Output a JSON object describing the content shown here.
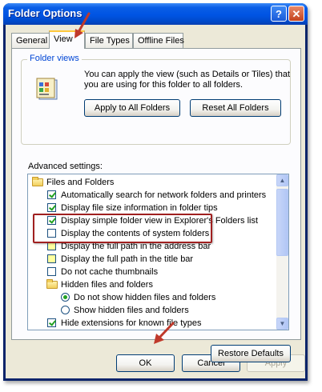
{
  "window": {
    "title": "Folder Options"
  },
  "titlebar_buttons": {
    "help": "?",
    "close": "✕"
  },
  "tabs": [
    {
      "label": "General",
      "active": false
    },
    {
      "label": "View",
      "active": true
    },
    {
      "label": "File Types",
      "active": false
    },
    {
      "label": "Offline Files",
      "active": false
    }
  ],
  "folder_views": {
    "label": "Folder views",
    "description": "You can apply the view (such as Details or Tiles) that you are using for this folder to all folders.",
    "apply_button": "Apply to All Folders",
    "reset_button": "Reset All Folders"
  },
  "advanced": {
    "label": "Advanced settings:",
    "items": [
      {
        "kind": "folder",
        "label": "Files and Folders"
      },
      {
        "kind": "checkbox",
        "checked": true,
        "label": "Automatically search for network folders and printers"
      },
      {
        "kind": "checkbox",
        "checked": true,
        "label": "Display file size information in folder tips"
      },
      {
        "kind": "checkbox",
        "checked": true,
        "label": "Display simple folder view in Explorer's Folders list"
      },
      {
        "kind": "checkbox",
        "checked": false,
        "label": "Display the contents of system folders"
      },
      {
        "kind": "checkbox",
        "checked": false,
        "label": "Display the full path in the address bar"
      },
      {
        "kind": "checkbox",
        "checked": false,
        "label": "Display the full path in the title bar"
      },
      {
        "kind": "checkbox",
        "checked": false,
        "label": "Do not cache thumbnails"
      },
      {
        "kind": "folder",
        "label": "Hidden files and folders"
      },
      {
        "kind": "radio",
        "checked": true,
        "label": "Do not show hidden files and folders"
      },
      {
        "kind": "radio",
        "checked": false,
        "label": "Show hidden files and folders"
      },
      {
        "kind": "checkbox",
        "checked": true,
        "label": "Hide extensions for known file types"
      }
    ]
  },
  "restore_button": "Restore Defaults",
  "dialog_buttons": {
    "ok": "OK",
    "cancel": "Cancel",
    "apply": "Apply"
  },
  "colors": {
    "titlebar": "#0054e3",
    "annotation": "#c0392b",
    "dialog_bg": "#ece9d8"
  }
}
